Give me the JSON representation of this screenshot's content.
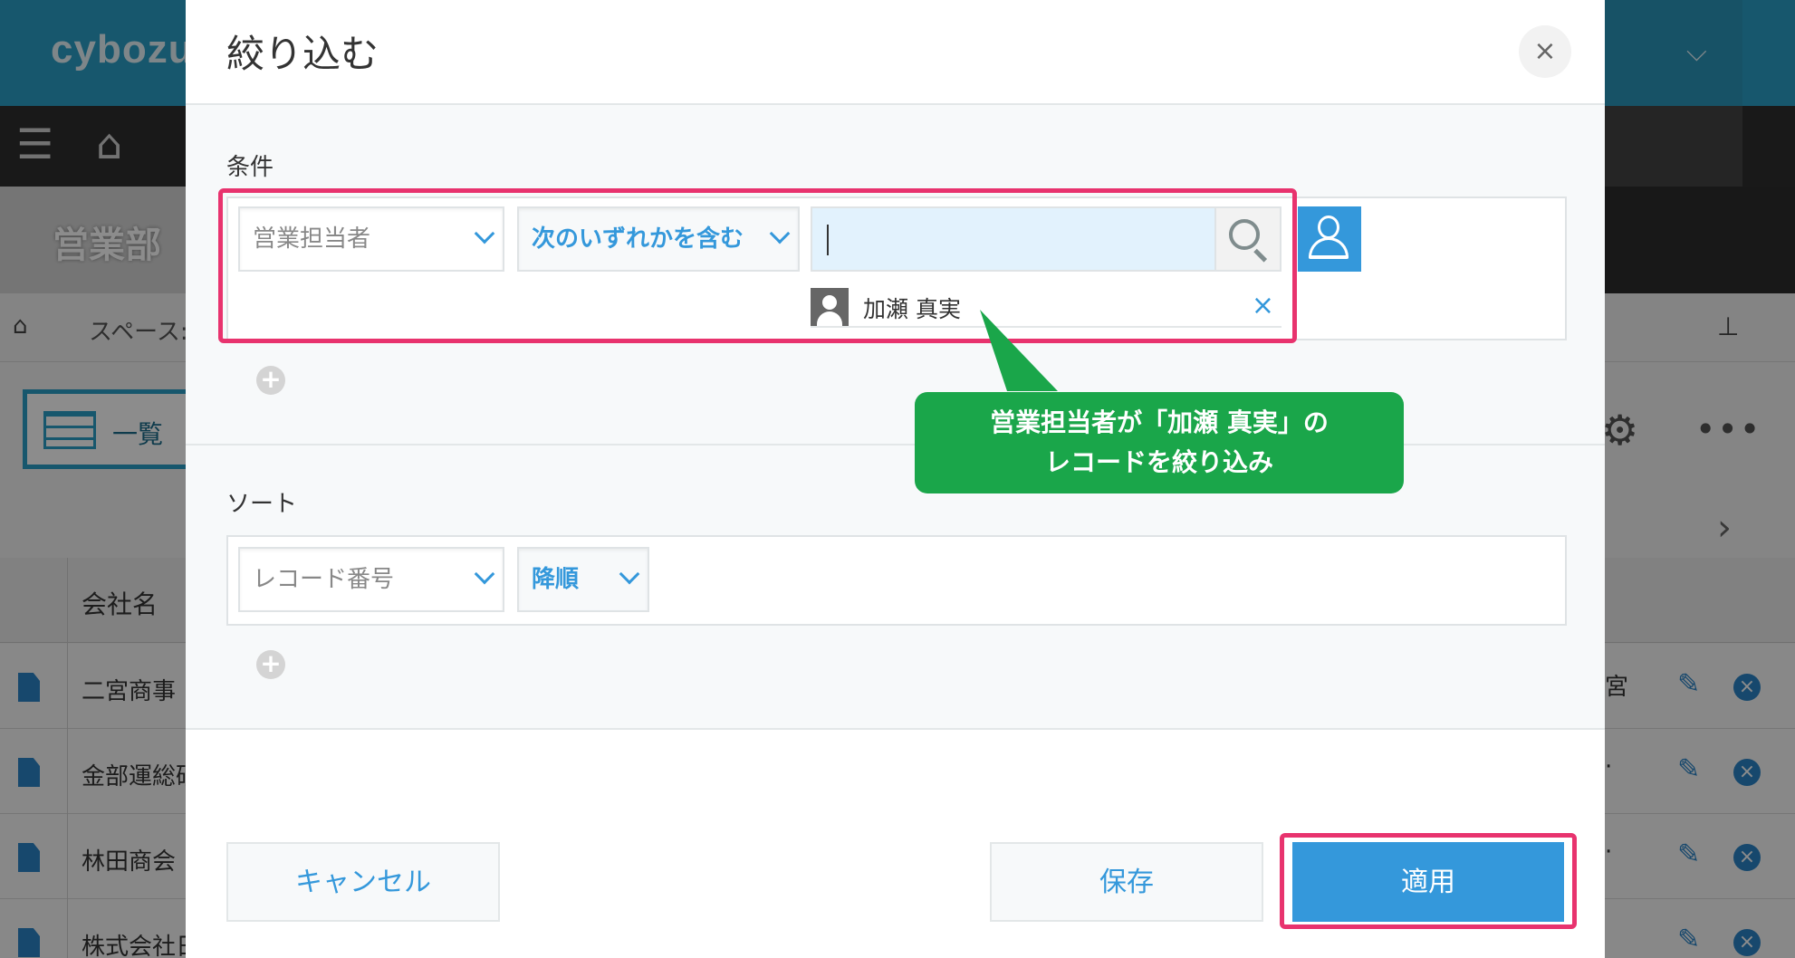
{
  "background": {
    "logo": "cybozu.",
    "space_title": "営業部",
    "breadcrumb": "スペース:",
    "view_label": "一覧",
    "table_header": "会社名",
    "rows": [
      "二宮商事",
      "金部運総研",
      "林田商会",
      "株式会社日"
    ]
  },
  "modal": {
    "title": "絞り込む",
    "close_label": "×",
    "conditions": {
      "label": "条件",
      "field_label": "営業担当者",
      "operator_label": "次のいずれかを含む",
      "input_value": "",
      "selected_user": "加瀬 真実",
      "remove_label": "×",
      "add_label": "+"
    },
    "sort": {
      "label": "ソート",
      "field_label": "レコード番号",
      "order_label": "降順",
      "add_label": "+"
    },
    "buttons": {
      "cancel": "キャンセル",
      "save": "保存",
      "apply": "適用"
    }
  },
  "annotation": {
    "line1": "営業担当者が「加瀬 真実」の",
    "line2": "レコードを絞り込み"
  },
  "colors": {
    "accent": "#3498db",
    "highlight": "#e8336e",
    "callout": "#1aa64a",
    "header": "#2b9fc6"
  },
  "icons": {
    "search": "search-icon",
    "user": "user-icon",
    "close": "close-icon",
    "add": "plus-circle-icon",
    "chevron": "chevron-down-icon"
  }
}
